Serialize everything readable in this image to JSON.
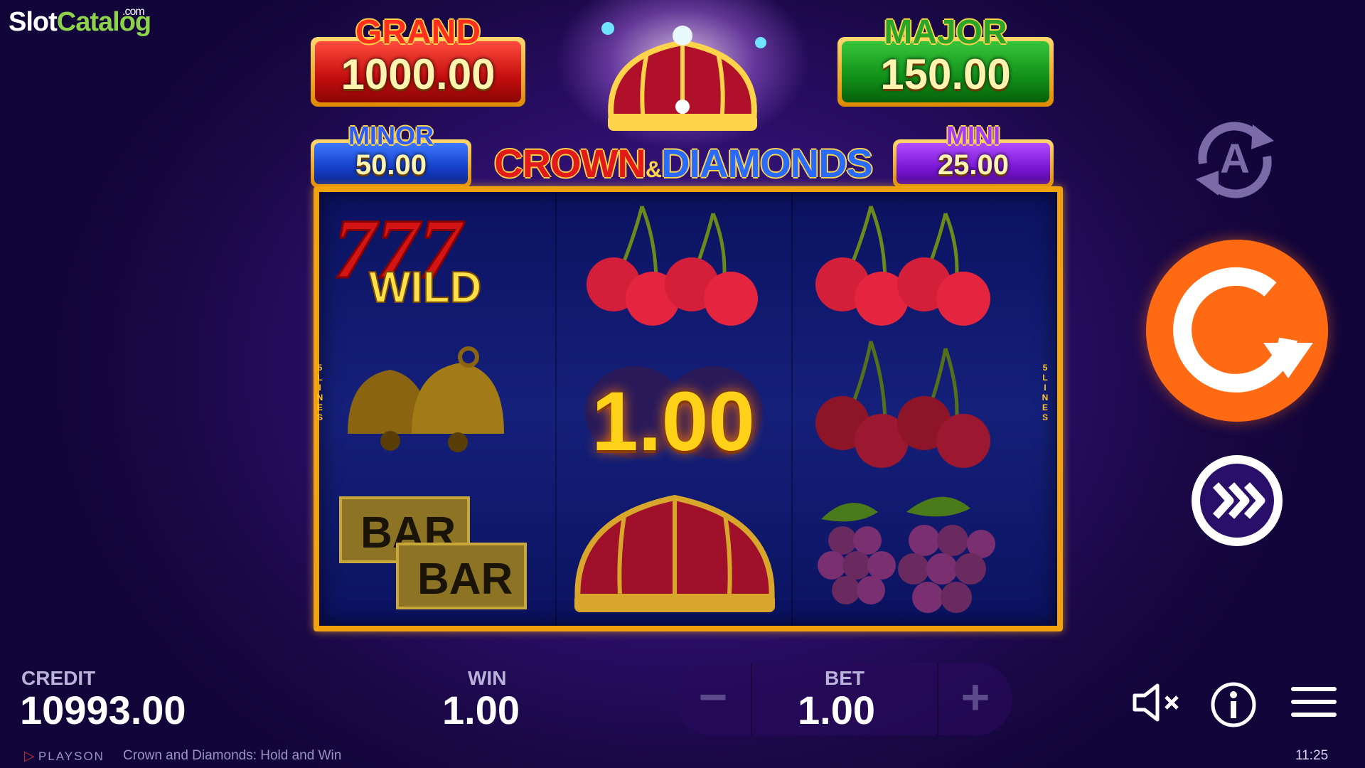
{
  "watermark": {
    "part1": "Slot",
    "part2": "Catalog",
    "suffix": ".com"
  },
  "jackpots": {
    "grand": {
      "label": "GRAND",
      "value": "1000.00"
    },
    "major": {
      "label": "MAJOR",
      "value": "150.00"
    },
    "minor": {
      "label": "MINOR",
      "value": "50.00"
    },
    "mini": {
      "label": "MINI",
      "value": "25.00"
    }
  },
  "logo": {
    "word1": "CROWN",
    "amp": "&",
    "word2": "DIAMONDS"
  },
  "reels": {
    "lines_label_left": [
      "5",
      "L",
      "I",
      "N",
      "E",
      "S"
    ],
    "lines_label_right": [
      "5",
      "L",
      "I",
      "N",
      "E",
      "S"
    ],
    "columns": [
      [
        "wild-777-icon",
        "bells-icon",
        "bar-bar-icon"
      ],
      [
        "cherries-icon",
        "plum-icon",
        "crown-icon"
      ],
      [
        "cherries-icon",
        "cherries-icon",
        "grapes-icon"
      ]
    ],
    "wild_text": "WILD",
    "bar_text": "BAR",
    "win_overlay": "1.00"
  },
  "controls": {
    "autoplay_letter": "A",
    "autoplay_icon": "autoplay-icon",
    "spin_icon": "spin-icon",
    "turbo_icon": "fast-forward-icon",
    "colors": {
      "spin": "#ff6a13",
      "accent": "#f2a20d"
    }
  },
  "bottom": {
    "credit_label": "CREDIT",
    "credit_value": "10993.00",
    "win_label": "WIN",
    "win_value": "1.00",
    "bet_label": "BET",
    "bet_value": "1.00",
    "minus": "−",
    "plus": "+"
  },
  "footer": {
    "brand": "PLAYSON",
    "game_title": "Crown and Diamonds: Hold and Win",
    "clock": "11:25"
  }
}
